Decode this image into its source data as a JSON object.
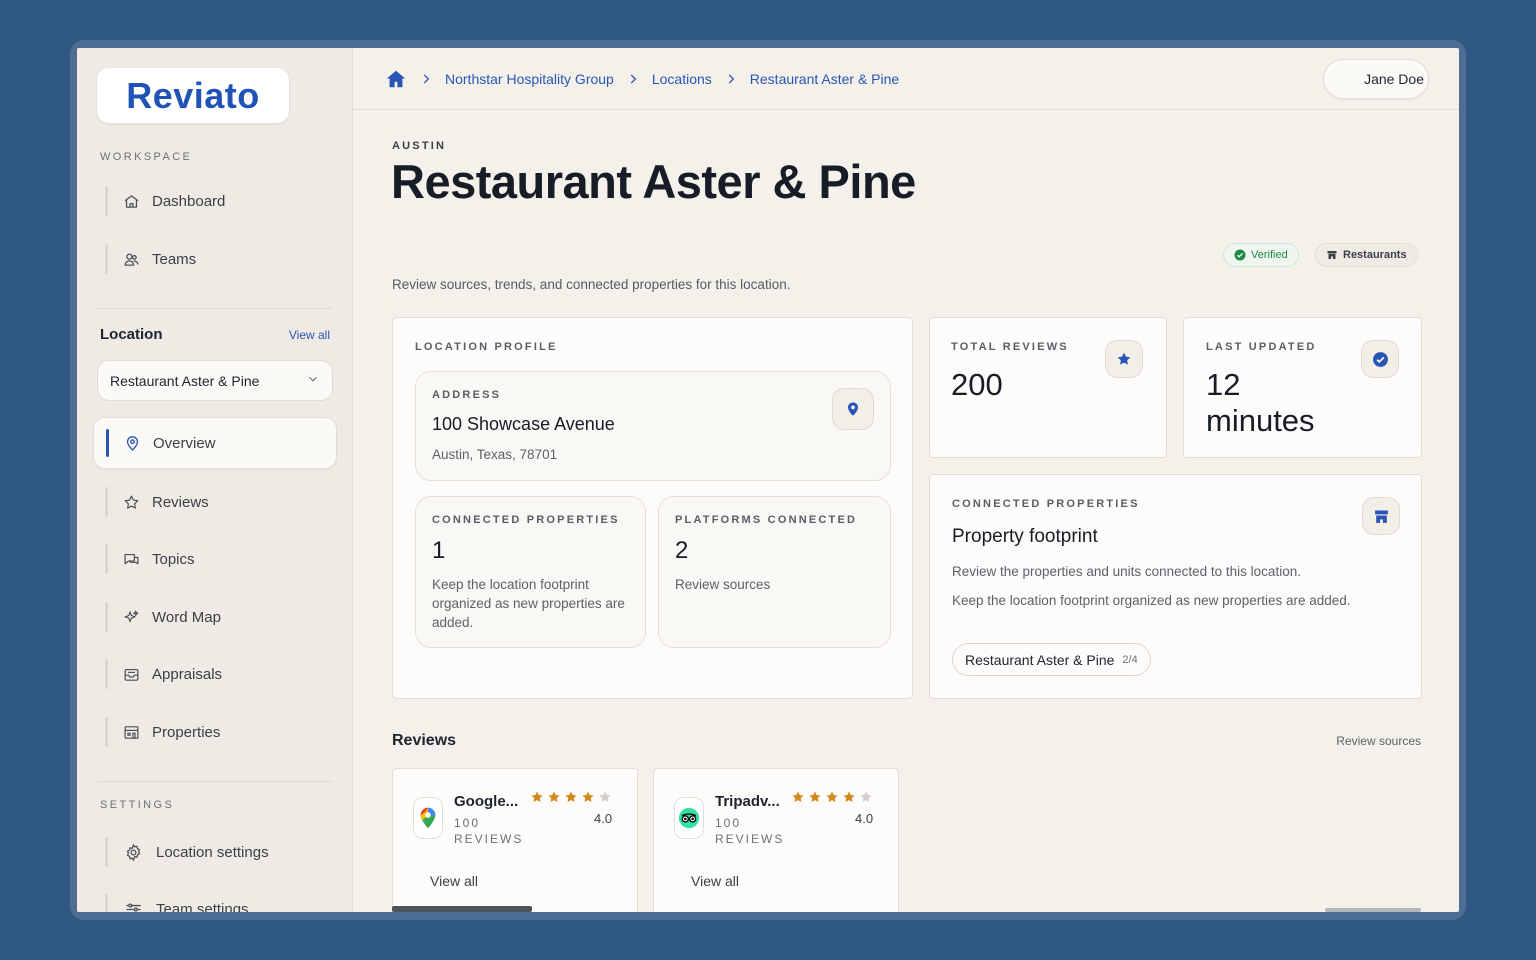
{
  "brand": {
    "logo_text": "Reviato"
  },
  "sidebar": {
    "workspace_label": "WORKSPACE",
    "workspace_items": [
      {
        "label": "Dashboard",
        "icon": "home-icon"
      },
      {
        "label": "Teams",
        "icon": "users-icon"
      }
    ],
    "location_title": "Location",
    "location_view_all": "View all",
    "location_select_value": "Restaurant Aster & Pine",
    "location_items": [
      {
        "label": "Overview",
        "icon": "map-pin-icon",
        "active": true
      },
      {
        "label": "Reviews",
        "icon": "star-icon"
      },
      {
        "label": "Topics",
        "icon": "chat-icon"
      },
      {
        "label": "Word Map",
        "icon": "sparkle-icon"
      },
      {
        "label": "Appraisals",
        "icon": "inbox-icon"
      },
      {
        "label": "Properties",
        "icon": "building-icon"
      }
    ],
    "settings_label": "SETTINGS",
    "settings_items": [
      {
        "label": "Location settings",
        "icon": "gear-icon"
      },
      {
        "label": "Team settings",
        "icon": "sliders-icon"
      }
    ]
  },
  "topbar": {
    "breadcrumbs": [
      "Northstar Hospitality Group",
      "Locations",
      "Restaurant Aster & Pine"
    ],
    "user_name": "Jane Doe"
  },
  "page": {
    "eyebrow": "AUSTIN",
    "title": "Restaurant Aster & Pine",
    "subtitle": "Review sources, trends, and connected properties for this location.",
    "badges": {
      "verified": "Verified",
      "category": "Restaurants"
    }
  },
  "profile": {
    "label": "LOCATION PROFILE",
    "address_label": "ADDRESS",
    "address_line1": "100 Showcase Avenue",
    "address_line2": "Austin, Texas, 78701",
    "connected_label": "CONNECTED PROPERTIES",
    "connected_value": "1",
    "connected_desc": "Keep the location footprint organized as new properties are added.",
    "platforms_label": "PLATFORMS CONNECTED",
    "platforms_value": "2",
    "platforms_desc": "Review sources"
  },
  "stats": {
    "total_reviews_label": "TOTAL REVIEWS",
    "total_reviews_value": "200",
    "last_updated_label": "LAST UPDATED",
    "last_updated_value": "12 minutes"
  },
  "footprint": {
    "label": "CONNECTED PROPERTIES",
    "title": "Property footprint",
    "desc1": "Review the properties and units connected to this location.",
    "desc2": "Keep the location footprint organized as new properties are added.",
    "chip_name": "Restaurant Aster & Pine",
    "chip_count": "2/4"
  },
  "reviews": {
    "title": "Reviews",
    "link": "Review sources",
    "sources": [
      {
        "name": "Google...",
        "count": "100 REVIEWS",
        "rating": "4.0",
        "stars": 4,
        "view_all": "View all",
        "icon": "google-maps-icon"
      },
      {
        "name": "Tripadv...",
        "count": "100 REVIEWS",
        "rating": "4.0",
        "stars": 4,
        "view_all": "View all",
        "icon": "tripadvisor-icon"
      }
    ]
  },
  "colors": {
    "accent": "#2a55b4",
    "star": "#d08a1c",
    "verified": "#1f8a45",
    "background": "#2f5883"
  }
}
